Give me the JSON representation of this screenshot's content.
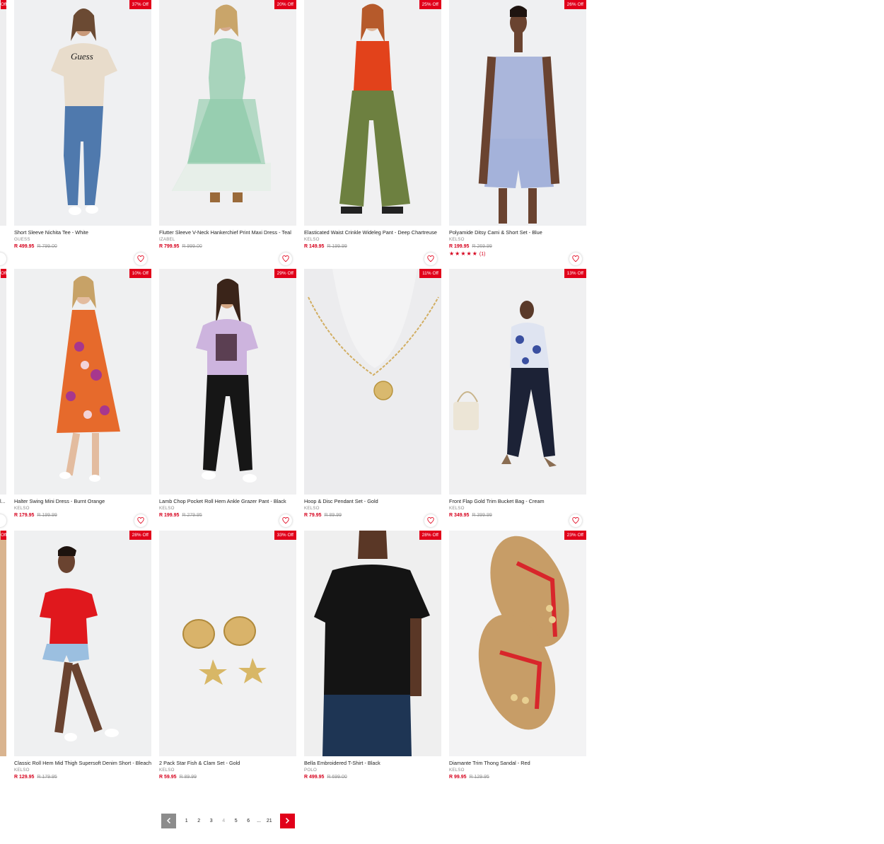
{
  "colors": {
    "accent": "#e1001a",
    "price": "#d6001c",
    "muted": "#999999"
  },
  "products": [
    {
      "discount": "37% Off",
      "title": "Short Sleeve Nichita Tee - White",
      "brand": "GUESS",
      "price": "R 499.95",
      "was": "R 799.00",
      "image": "woman-white-tee-jeans"
    },
    {
      "discount": "20% Off",
      "title": "Flutter Sleeve V-Neck Hankerchief Print Maxi Dress - Teal",
      "brand": "IZABEL",
      "price": "R 799.95",
      "was": "R 999.00",
      "image": "woman-teal-print-maxi-dress"
    },
    {
      "discount": "25% Off",
      "title": "Elasticated Waist Crinkle Wideleg Pant - Deep Chartreuse",
      "brand": "KELSO",
      "price": "R 149.95",
      "was": "R 199.99",
      "image": "woman-green-wideleg-pant"
    },
    {
      "discount": "26% Off",
      "title": "Polyamide Ditsy Cami & Short Set - Blue",
      "brand": "KELSO",
      "price": "R 199.95",
      "was": "R 269.99",
      "rating": "★★★★★",
      "reviews": "(1)",
      "image": "woman-blue-cami-short-set"
    },
    {
      "discount": "10% Off",
      "title": "Halter Swing Mini Dress - Burnt Orange",
      "brand": "KELSO",
      "price": "R 179.95",
      "was": "R 199.99",
      "image": "woman-orange-halter-dress"
    },
    {
      "discount": "29% Off",
      "title": "Lamb Chop Pocket Roll Hem Ankle Grazer Pant - Black",
      "brand": "KELSO",
      "price": "R 199.95",
      "was": "R 279.95",
      "image": "woman-black-grazer-pant"
    },
    {
      "discount": "11% Off",
      "title": "Hoop & Disc Pendant Set - Gold",
      "brand": "KELSO",
      "price": "R 79.95",
      "was": "R 89.99",
      "image": "gold-disc-pendant"
    },
    {
      "discount": "13% Off",
      "title": "Front Flap Gold Trim Bucket Bag - Cream",
      "brand": "KELSO",
      "price": "R 349.95",
      "was": "R 399.99",
      "image": "woman-cream-bucket-bag"
    },
    {
      "discount": "28% Off",
      "title": "Classic Roll Hem Mid Thigh Supersoft Denim Short - Bleach",
      "brand": "KELSO",
      "price": "R 129.95",
      "was": "R 179.95",
      "image": "woman-denim-short"
    },
    {
      "discount": "33% Off",
      "title": "2 Pack Star Fish & Clam Set - Gold",
      "brand": "KELSO",
      "price": "R 59.95",
      "was": "R 89.99",
      "image": "gold-shell-starfish-earrings"
    },
    {
      "discount": "28% Off",
      "title": "Bella Embroidered T-Shirt - Black",
      "brand": "POLO",
      "price": "R 499.95",
      "was": "R 699.00",
      "image": "woman-black-tee"
    },
    {
      "discount": "23% Off",
      "title": "Diamante Trim Thong Sandal - Red",
      "brand": "KELSO",
      "price": "R 99.95",
      "was": "R 129.95",
      "image": "red-thong-sandals"
    }
  ],
  "edge_column": [
    {
      "badge": "Off",
      "text": ""
    },
    {
      "badge": "Off",
      "text": "l..."
    },
    {
      "badge": "Off",
      "text": ""
    }
  ],
  "pagination": {
    "pages": [
      "1",
      "2",
      "3",
      "4",
      "5",
      "6"
    ],
    "current": "4",
    "ellipsis": "...",
    "last": "21"
  }
}
